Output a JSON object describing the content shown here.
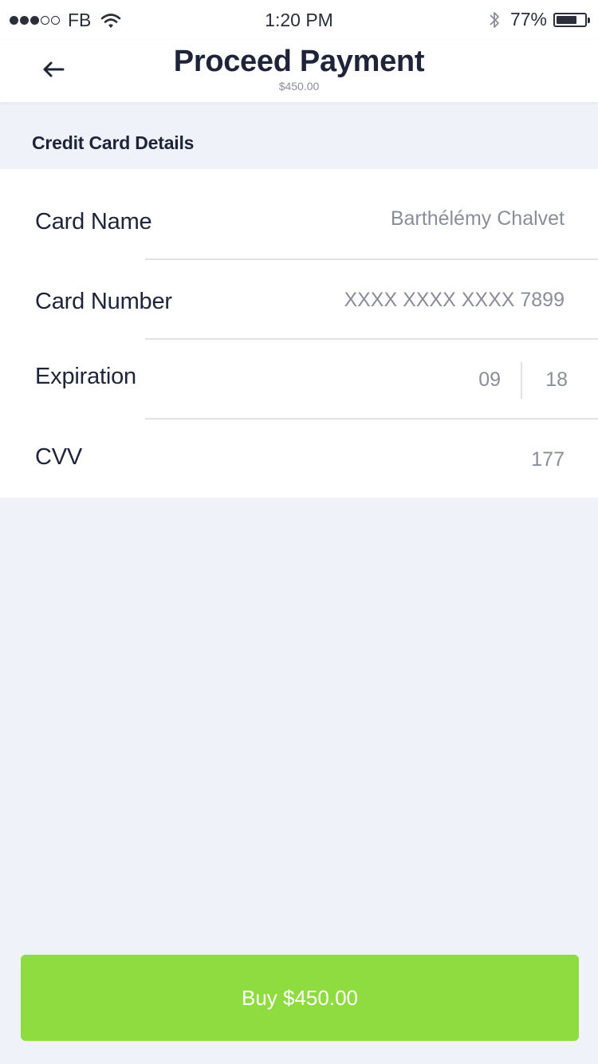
{
  "status_bar": {
    "carrier": "FB",
    "time": "1:20 PM",
    "battery_percent": "77%",
    "battery_level": 0.77,
    "signal_strength": 3,
    "signal_max": 5,
    "icons": [
      "signal-dots",
      "wifi-icon",
      "bluetooth-icon",
      "battery-icon"
    ]
  },
  "header": {
    "back_icon": "arrow-left-icon",
    "title": "Proceed Payment",
    "subtitle": "$450.00"
  },
  "section": {
    "title": "Credit Card Details"
  },
  "form": {
    "card_name": {
      "label": "Card Name",
      "value": "Barthélémy Chalvet"
    },
    "card_number": {
      "label": "Card Number",
      "value": "XXXX XXXX XXXX 7899"
    },
    "expiration": {
      "label": "Expiration",
      "month": "09",
      "year": "18"
    },
    "cvv": {
      "label": "CVV",
      "value": "177"
    }
  },
  "buy_button": {
    "label": "Buy $450.00"
  },
  "colors": {
    "background": "#f0f2f9",
    "accent_green": "#8edc3f",
    "text_dark": "#1f2538",
    "text_muted": "#8a8e99",
    "divider": "#dfe1e6"
  }
}
